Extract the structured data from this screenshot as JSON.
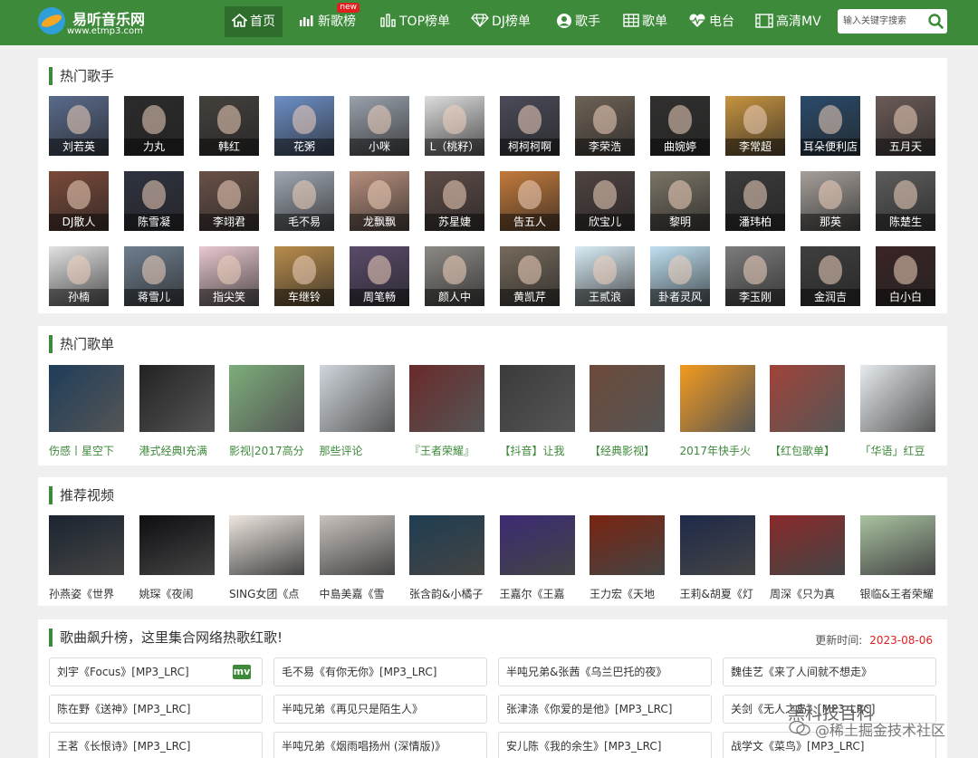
{
  "site": {
    "name": "易听音乐网",
    "url": "www.etmp3.com"
  },
  "nav": {
    "items": [
      {
        "label": "首页",
        "icon": "home-icon"
      },
      {
        "label": "新歌榜",
        "icon": "bar-chart-icon",
        "badge": "new"
      },
      {
        "label": "TOP榜单",
        "icon": "top-chart-icon"
      },
      {
        "label": "DJ榜单",
        "icon": "diamond-icon"
      },
      {
        "label": "歌手",
        "icon": "user-icon"
      },
      {
        "label": "歌单",
        "icon": "grid-icon"
      },
      {
        "label": "电台",
        "icon": "heartbeat-icon"
      },
      {
        "label": "高清MV",
        "icon": "film-icon"
      }
    ],
    "active_index": 0
  },
  "search": {
    "placeholder": "输入关键字搜索",
    "icon": "search-icon"
  },
  "hot_singers": {
    "title": "热门歌手",
    "items": [
      "刘若英",
      "力丸",
      "韩红",
      "花粥",
      "小咪",
      "L（桃籽）",
      "柯柯柯啊",
      "李荣浩",
      "曲婉婷",
      "李常超",
      "耳朵便利店",
      "五月天",
      "DJ散人",
      "陈雪凝",
      "李翊君",
      "毛不易",
      "龙飘飘",
      "苏星婕",
      "告五人",
      "欣宝儿",
      "黎明",
      "潘玮柏",
      "那英",
      "陈楚生",
      "孙楠",
      "蒋雪儿",
      "指尖笑",
      "车继铃",
      "周笔畅",
      "颜人中",
      "黄凯芹",
      "王贰浪",
      "卦者灵风",
      "李玉刚",
      "金润吉",
      "白小白"
    ]
  },
  "hot_playlists": {
    "title": "热门歌单",
    "items": [
      "伤感丨星空下",
      "港式经典I充满",
      "影视|2017高分",
      "那些评论",
      "『王者荣耀』",
      "【抖音】让我",
      "【经典影视】",
      "2017年快手火",
      "【红包歌单】",
      "「华语」红豆"
    ]
  },
  "videos": {
    "title": "推荐视频",
    "items": [
      "孙燕姿《世界",
      "姚琛《夜闹",
      "SING女团《点",
      "中島美嘉《雪",
      "张含韵&小橘子",
      "王嘉尔《王嘉",
      "王力宏《天地",
      "王莉&胡夏《灯",
      "周深《只为真",
      "银临&王者荣耀"
    ]
  },
  "chart": {
    "title": "歌曲飙升榜，这里集合网络热歌红歌!",
    "update_label": "更新时间:",
    "update_date": "2023-08-06",
    "mv_label": "mv",
    "songs": [
      "刘宇《Focus》[MP3_LRC]",
      "毛不易《有你无你》[MP3_LRC]",
      "半吨兄弟&张茜《乌兰巴托的夜》",
      "魏佳艺《来了人间就不想走》",
      "陈在野《送神》[MP3_LRC]",
      "半吨兄弟《再见只是陌生人》",
      "张津涤《你爱的是他》[MP3_LRC]",
      "关剑《无人之岛》[MP3_LRC]",
      "王茗《长恨诗》[MP3_LRC]",
      "半吨兄弟《烟雨唱扬州 (深情版)》",
      "安儿陈《我的余生》[MP3_LRC]",
      "战学文《菜鸟》[MP3_LRC]"
    ]
  },
  "watermark": {
    "line1": "黑科技百科",
    "line2": "@稀土掘金技术社区"
  }
}
